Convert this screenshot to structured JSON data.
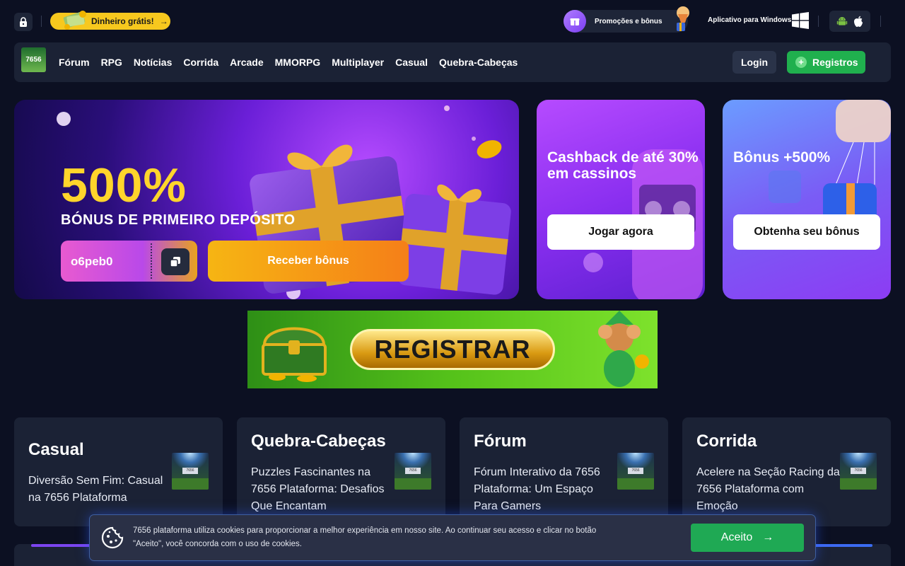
{
  "topbar": {
    "free_money": "Dinheiro grátis!",
    "promotions": "Promoções e bônus",
    "windows_app": "Aplicativo para Windows"
  },
  "nav": {
    "logo_text": "7656",
    "links": [
      "Fórum",
      "RPG",
      "Notícias",
      "Corrida",
      "Arcade",
      "MMORPG",
      "Multiplayer",
      "Casual",
      "Quebra-Cabeças"
    ],
    "login": "Login",
    "register": "Registros"
  },
  "hero": {
    "percent": "500%",
    "subtitle": "BÓNUS DE PRIMEIRO DEPÓSITO",
    "promo_code": "o6peb0",
    "receive_button": "Receber bônus"
  },
  "cards": {
    "cashback": {
      "title": "Cashback de até 30% em cassinos",
      "button": "Jogar agora"
    },
    "bonus": {
      "title": "Bônus +500%",
      "button": "Obtenha seu bônus"
    }
  },
  "register_banner": {
    "text": "REGISTRAR"
  },
  "categories": [
    {
      "title": "Casual",
      "desc": "Diversão Sem Fim: Casual na 7656 Plataforma"
    },
    {
      "title": "Quebra-Cabeças",
      "desc": "Puzzles Fascinantes na 7656 Plataforma: Desafios Que Encantam"
    },
    {
      "title": "Fórum",
      "desc": "Fórum Interativo da 7656 Plataforma: Um Espaço Para Gamers"
    },
    {
      "title": "Corrida",
      "desc": "Acelere na Seção Racing da 7656 Plataforma com Emoção"
    }
  ],
  "thumb_label": "7656",
  "cookie": {
    "text": "7656 plataforma utiliza cookies para proporcionar a melhor experiência em nosso site. Ao continuar seu acesso e clicar no botão \"Aceito\", você concorda com o uso de cookies.",
    "accept": "Aceito"
  }
}
